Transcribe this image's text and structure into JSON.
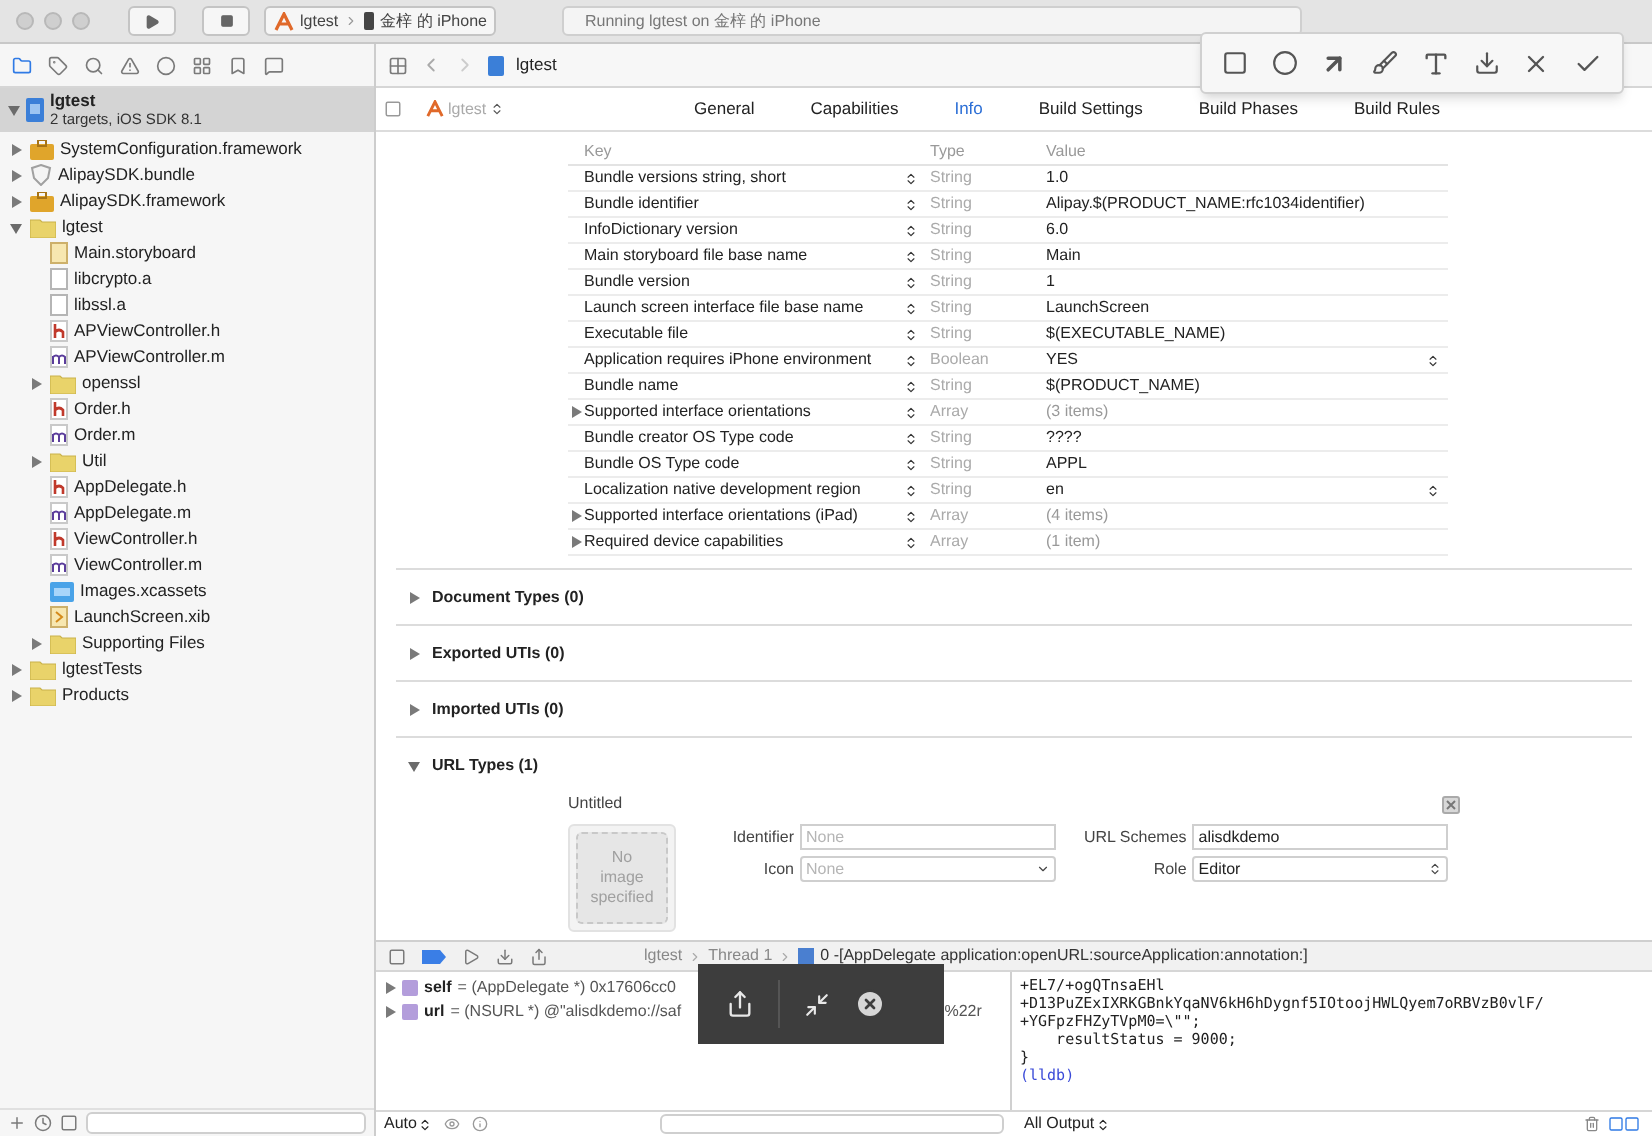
{
  "toolbar": {
    "scheme": "lgtest",
    "device": "金梓 的 iPhone",
    "status": "Running lgtest on 金梓 的 iPhone"
  },
  "navigator": {
    "project": {
      "name": "lgtest",
      "subtitle": "2 targets, iOS SDK 8.1",
      "expanded": true,
      "selected": true
    },
    "items": [
      {
        "name": "SystemConfiguration.framework",
        "kind": "framework",
        "expanded": false,
        "selected": false
      },
      {
        "name": "AlipaySDK.bundle",
        "kind": "bundle",
        "expanded": false,
        "selected": false
      },
      {
        "name": "AlipaySDK.framework",
        "kind": "framework",
        "expanded": false,
        "selected": false
      },
      {
        "name": "lgtest",
        "kind": "folder",
        "expanded": true,
        "selected": false,
        "children": [
          {
            "name": "Main.storyboard",
            "kind": "storyboard",
            "selected": false
          },
          {
            "name": "libcrypto.a",
            "kind": "lib",
            "selected": false
          },
          {
            "name": "libssl.a",
            "kind": "lib",
            "selected": false
          },
          {
            "name": "APViewController.h",
            "kind": "header",
            "selected": false
          },
          {
            "name": "APViewController.m",
            "kind": "source",
            "selected": false
          },
          {
            "name": "openssl",
            "kind": "folder",
            "expanded": false,
            "selected": false
          },
          {
            "name": "Order.h",
            "kind": "header",
            "selected": false
          },
          {
            "name": "Order.m",
            "kind": "source",
            "selected": false
          },
          {
            "name": "Util",
            "kind": "folder",
            "expanded": false,
            "selected": false
          },
          {
            "name": "AppDelegate.h",
            "kind": "header",
            "selected": false
          },
          {
            "name": "AppDelegate.m",
            "kind": "source",
            "selected": false
          },
          {
            "name": "ViewController.h",
            "kind": "header",
            "selected": false
          },
          {
            "name": "ViewController.m",
            "kind": "source",
            "selected": false
          },
          {
            "name": "Images.xcassets",
            "kind": "assets",
            "selected": false
          },
          {
            "name": "LaunchScreen.xib",
            "kind": "xib",
            "selected": false
          },
          {
            "name": "Supporting Files",
            "kind": "folder",
            "expanded": false,
            "selected": false
          }
        ]
      },
      {
        "name": "lgtestTests",
        "kind": "folder",
        "expanded": false,
        "selected": false
      },
      {
        "name": "Products",
        "kind": "folder",
        "expanded": false,
        "selected": false
      }
    ]
  },
  "jump_bar": {
    "file": "lgtest"
  },
  "editor_tabs": {
    "target": "lgtest",
    "tabs": [
      {
        "label": "General",
        "selected": false
      },
      {
        "label": "Capabilities",
        "selected": false
      },
      {
        "label": "Info",
        "selected": true
      },
      {
        "label": "Build Settings",
        "selected": false
      },
      {
        "label": "Build Phases",
        "selected": false
      },
      {
        "label": "Build Rules",
        "selected": false
      }
    ]
  },
  "info_table": {
    "columns": [
      "Key",
      "Type",
      "Value"
    ],
    "rows": [
      {
        "key": "Bundle versions string, short",
        "type": "String",
        "value": "1.0",
        "kind": "text"
      },
      {
        "key": "Bundle identifier",
        "type": "String",
        "value": "Alipay.$(PRODUCT_NAME:rfc1034identifier)",
        "kind": "text"
      },
      {
        "key": "InfoDictionary version",
        "type": "String",
        "value": "6.0",
        "kind": "text"
      },
      {
        "key": "Main storyboard file base name",
        "type": "String",
        "value": "Main",
        "kind": "text"
      },
      {
        "key": "Bundle version",
        "type": "String",
        "value": "1",
        "kind": "text"
      },
      {
        "key": "Launch screen interface file base name",
        "type": "String",
        "value": "LaunchScreen",
        "kind": "text"
      },
      {
        "key": "Executable file",
        "type": "String",
        "value": "$(EXECUTABLE_NAME)",
        "kind": "text"
      },
      {
        "key": "Application requires iPhone environment",
        "type": "Boolean",
        "value": "YES",
        "kind": "choice"
      },
      {
        "key": "Bundle name",
        "type": "String",
        "value": "$(PRODUCT_NAME)",
        "kind": "text"
      },
      {
        "key": "Supported interface orientations",
        "type": "Array",
        "value": "(3 items)",
        "kind": "array",
        "expanded": false
      },
      {
        "key": "Bundle creator OS Type code",
        "type": "String",
        "value": "????",
        "kind": "text"
      },
      {
        "key": "Bundle OS Type code",
        "type": "String",
        "value": "APPL",
        "kind": "text"
      },
      {
        "key": "Localization native development region",
        "type": "String",
        "value": "en",
        "kind": "choice"
      },
      {
        "key": "Supported interface orientations (iPad)",
        "type": "Array",
        "value": "(4 items)",
        "kind": "array",
        "expanded": false
      },
      {
        "key": "Required device capabilities",
        "type": "Array",
        "value": "(1 item)",
        "kind": "array",
        "expanded": false
      }
    ]
  },
  "sections": [
    {
      "title": "Document Types (0)",
      "expanded": false
    },
    {
      "title": "Exported UTIs (0)",
      "expanded": false
    },
    {
      "title": "Imported UTIs (0)",
      "expanded": false
    },
    {
      "title": "URL Types (1)",
      "expanded": true
    }
  ],
  "url_type": {
    "title": "Untitled",
    "image_placeholder": "No image specified",
    "identifier": {
      "label": "Identifier",
      "placeholder": "None"
    },
    "url_schemes": {
      "label": "URL Schemes",
      "value": "alisdkdemo"
    },
    "icon": {
      "label": "Icon",
      "placeholder": "None"
    },
    "role": {
      "label": "Role",
      "value": "Editor"
    }
  },
  "debug": {
    "breadcrumbs": [
      "lgtest",
      "Thread 1",
      "0 -[AppDelegate application:openURL:sourceApplication:annotation:]"
    ],
    "variables": [
      {
        "name": "self",
        "value": "= (AppDelegate *) 0x17606cc0"
      },
      {
        "name": "url",
        "value": "= (NSURL *) @\"alisdkdemo://saf",
        "value_tail": "%22r"
      }
    ],
    "console": [
      "+EL7/+ogQTnsaEHl",
      "+D13PuZExIXRKGBnkYqaNV6kH6hDygnf5IOtoojHWLQyem7oRBVzB0vlF/",
      "+YGFpzFHZyTVpM0=\\\"\";",
      "    resultStatus = 9000;",
      "}"
    ],
    "prompt": "(lldb)",
    "scope": "Auto",
    "output": "All Output"
  }
}
